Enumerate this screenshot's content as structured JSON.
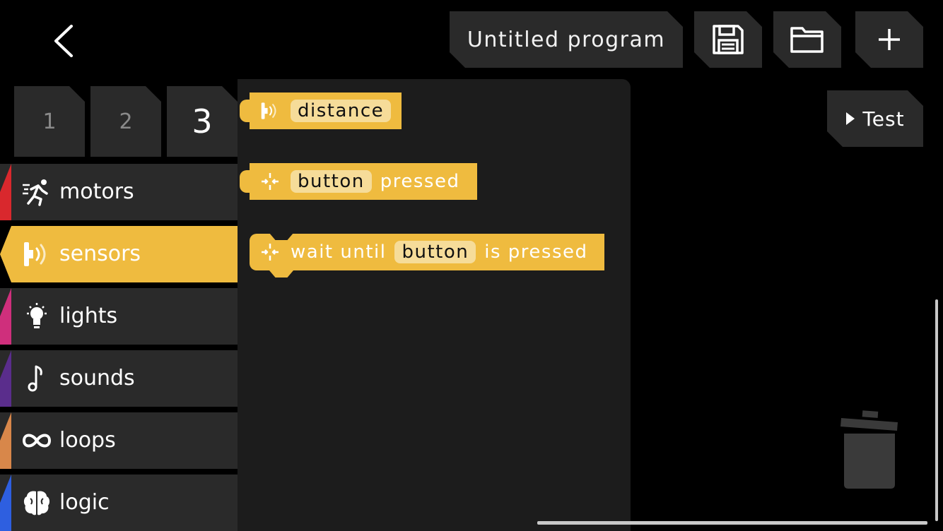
{
  "header": {
    "back_icon": "chevron-left-icon",
    "program_title": "Untitled program",
    "save_icon": "floppy-disk-icon",
    "open_icon": "folder-icon",
    "new_icon": "plus-icon"
  },
  "page_tabs": [
    {
      "label": "1",
      "active": false
    },
    {
      "label": "2",
      "active": false
    },
    {
      "label": "3",
      "active": true
    }
  ],
  "categories": [
    {
      "label": "motors",
      "icon": "running-person-icon",
      "color": "#d9282d"
    },
    {
      "label": "sensors",
      "icon": "sensor-icon",
      "color": "#efbb3f",
      "active": true
    },
    {
      "label": "lights",
      "icon": "lightbulb-icon",
      "color": "#cf2f7c"
    },
    {
      "label": "sounds",
      "icon": "music-note-icon",
      "color": "#5a2d8c"
    },
    {
      "label": "loops",
      "icon": "infinity-icon",
      "color": "#d8874a"
    },
    {
      "label": "logic",
      "icon": "brain-icon",
      "color": "#2e5fe0"
    }
  ],
  "blocks": {
    "distance": {
      "icon": "sensor-icon",
      "pill": "distance"
    },
    "button_pressed": {
      "icon": "button-press-icon",
      "pill": "button",
      "text": "pressed"
    },
    "wait_until": {
      "icon": "button-press-icon",
      "prefix": "wait until",
      "pill": "button",
      "suffix": "is pressed"
    }
  },
  "test_button": {
    "label": "Test",
    "icon": "play-icon"
  },
  "trash_icon": "trash-can-icon",
  "colors": {
    "accent": "#efbb3f",
    "panel": "#2a2a2a",
    "flyout": "#1c1c1c"
  }
}
